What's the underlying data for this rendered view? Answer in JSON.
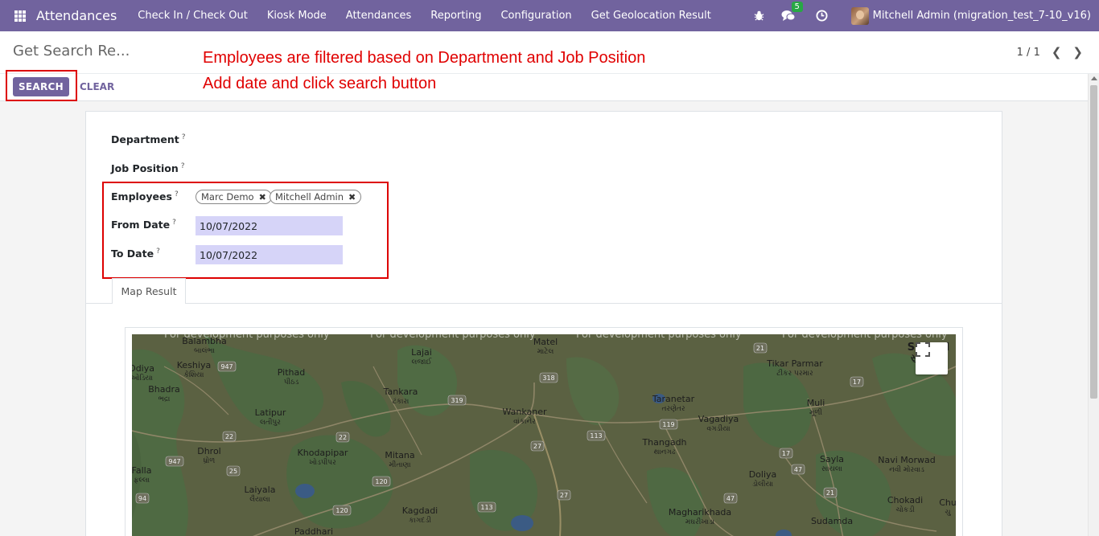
{
  "navbar": {
    "app_name": "Attendances",
    "menu": [
      "Check In / Check Out",
      "Kiosk Mode",
      "Attendances",
      "Reporting",
      "Configuration",
      "Get Geolocation Result"
    ],
    "messages_badge": "5",
    "user": "Mitchell Admin (migration_test_7-10_v16)"
  },
  "control_panel": {
    "breadcrumb": "Get Search Re...",
    "search_label": "SEARCH",
    "clear_label": "CLEAR",
    "pager": "1 / 1"
  },
  "annotations": {
    "line1": "Employees are filtered based on Department and Job Position",
    "line2": "Add date and click search button"
  },
  "form": {
    "department_label": "Department",
    "job_position_label": "Job Position",
    "employees_label": "Employees",
    "from_date_label": "From Date",
    "to_date_label": "To Date",
    "help_mark": "?",
    "employees": [
      "Marc Demo",
      "Mitchell Admin"
    ],
    "from_date": "10/07/2022",
    "to_date": "10/07/2022",
    "tab": "Map Result"
  },
  "map": {
    "watermark": "For development purposes only",
    "places": [
      {
        "en": "Balambha",
        "local": "બાલંભા"
      },
      {
        "en": "Odiya",
        "local": "ઓડિયા"
      },
      {
        "en": "Keshiya",
        "local": "કેશિયા"
      },
      {
        "en": "Bhadra",
        "local": "ભદ્રા"
      },
      {
        "en": "Pithad",
        "local": "પીઠડ"
      },
      {
        "en": "Latipur",
        "local": "લતીપુર"
      },
      {
        "en": "Dhrol",
        "local": "ધ્રોળ"
      },
      {
        "en": "Falla",
        "local": "ફલ્લા"
      },
      {
        "en": "Khodapipar",
        "local": "ખોડપીપર"
      },
      {
        "en": "Laiyala",
        "local": "લૈયાલા"
      },
      {
        "en": "Lajai",
        "local": "લજાઈ"
      },
      {
        "en": "Tankara",
        "local": "ટંકારા"
      },
      {
        "en": "Mitana",
        "local": "મીતાણા"
      },
      {
        "en": "Kagdadi",
        "local": "કાગદડી"
      },
      {
        "en": "Paddhari",
        "local": ""
      },
      {
        "en": "Matel",
        "local": "માટેલ"
      },
      {
        "en": "Wankaner",
        "local": "વાંકાનેર"
      },
      {
        "en": "Taranetar",
        "local": "તરણેતર"
      },
      {
        "en": "Thangadh",
        "local": "થાનગઢ"
      },
      {
        "en": "Vagadiya",
        "local": "વગડીયા"
      },
      {
        "en": "Tikar Parmar",
        "local": "ટીકર પરમાર"
      },
      {
        "en": "Muli",
        "local": "મૂળી"
      },
      {
        "en": "Surend",
        "local": "સુરે"
      },
      {
        "en": "Doliya",
        "local": "ડોલીયા"
      },
      {
        "en": "Sayla",
        "local": "સાયલા"
      },
      {
        "en": "Navi Morwad",
        "local": "નવી મોરવાડ"
      },
      {
        "en": "Chokadi",
        "local": "ચોકડી"
      },
      {
        "en": "Magharikhada",
        "local": "મઘરીખાડા"
      },
      {
        "en": "Sudamda",
        "local": ""
      },
      {
        "en": "Chu",
        "local": "ચુ"
      }
    ],
    "roads": [
      "947",
      "22",
      "22",
      "947",
      "25",
      "94",
      "319",
      "120",
      "113",
      "318",
      "27",
      "27",
      "113",
      "119",
      "21",
      "17",
      "17",
      "47",
      "47",
      "21",
      "120"
    ]
  }
}
